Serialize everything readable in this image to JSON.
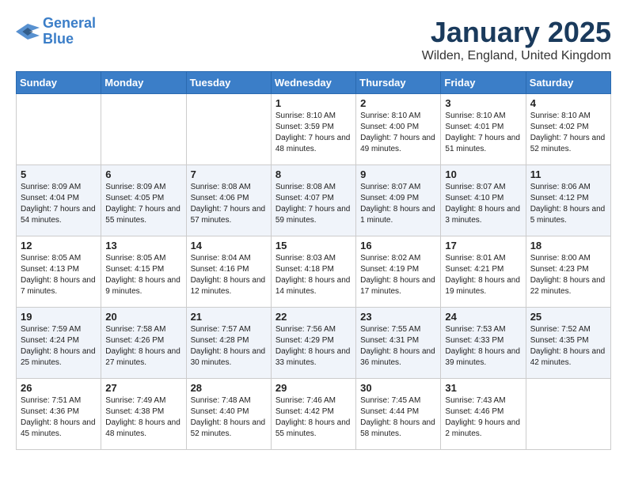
{
  "header": {
    "logo_line1": "General",
    "logo_line2": "Blue",
    "month": "January 2025",
    "location": "Wilden, England, United Kingdom"
  },
  "days_of_week": [
    "Sunday",
    "Monday",
    "Tuesday",
    "Wednesday",
    "Thursday",
    "Friday",
    "Saturday"
  ],
  "weeks": [
    [
      {
        "day": "",
        "detail": ""
      },
      {
        "day": "",
        "detail": ""
      },
      {
        "day": "",
        "detail": ""
      },
      {
        "day": "1",
        "detail": "Sunrise: 8:10 AM\nSunset: 3:59 PM\nDaylight: 7 hours\nand 48 minutes."
      },
      {
        "day": "2",
        "detail": "Sunrise: 8:10 AM\nSunset: 4:00 PM\nDaylight: 7 hours\nand 49 minutes."
      },
      {
        "day": "3",
        "detail": "Sunrise: 8:10 AM\nSunset: 4:01 PM\nDaylight: 7 hours\nand 51 minutes."
      },
      {
        "day": "4",
        "detail": "Sunrise: 8:10 AM\nSunset: 4:02 PM\nDaylight: 7 hours\nand 52 minutes."
      }
    ],
    [
      {
        "day": "5",
        "detail": "Sunrise: 8:09 AM\nSunset: 4:04 PM\nDaylight: 7 hours\nand 54 minutes."
      },
      {
        "day": "6",
        "detail": "Sunrise: 8:09 AM\nSunset: 4:05 PM\nDaylight: 7 hours\nand 55 minutes."
      },
      {
        "day": "7",
        "detail": "Sunrise: 8:08 AM\nSunset: 4:06 PM\nDaylight: 7 hours\nand 57 minutes."
      },
      {
        "day": "8",
        "detail": "Sunrise: 8:08 AM\nSunset: 4:07 PM\nDaylight: 7 hours\nand 59 minutes."
      },
      {
        "day": "9",
        "detail": "Sunrise: 8:07 AM\nSunset: 4:09 PM\nDaylight: 8 hours\nand 1 minute."
      },
      {
        "day": "10",
        "detail": "Sunrise: 8:07 AM\nSunset: 4:10 PM\nDaylight: 8 hours\nand 3 minutes."
      },
      {
        "day": "11",
        "detail": "Sunrise: 8:06 AM\nSunset: 4:12 PM\nDaylight: 8 hours\nand 5 minutes."
      }
    ],
    [
      {
        "day": "12",
        "detail": "Sunrise: 8:05 AM\nSunset: 4:13 PM\nDaylight: 8 hours\nand 7 minutes."
      },
      {
        "day": "13",
        "detail": "Sunrise: 8:05 AM\nSunset: 4:15 PM\nDaylight: 8 hours\nand 9 minutes."
      },
      {
        "day": "14",
        "detail": "Sunrise: 8:04 AM\nSunset: 4:16 PM\nDaylight: 8 hours\nand 12 minutes."
      },
      {
        "day": "15",
        "detail": "Sunrise: 8:03 AM\nSunset: 4:18 PM\nDaylight: 8 hours\nand 14 minutes."
      },
      {
        "day": "16",
        "detail": "Sunrise: 8:02 AM\nSunset: 4:19 PM\nDaylight: 8 hours\nand 17 minutes."
      },
      {
        "day": "17",
        "detail": "Sunrise: 8:01 AM\nSunset: 4:21 PM\nDaylight: 8 hours\nand 19 minutes."
      },
      {
        "day": "18",
        "detail": "Sunrise: 8:00 AM\nSunset: 4:23 PM\nDaylight: 8 hours\nand 22 minutes."
      }
    ],
    [
      {
        "day": "19",
        "detail": "Sunrise: 7:59 AM\nSunset: 4:24 PM\nDaylight: 8 hours\nand 25 minutes."
      },
      {
        "day": "20",
        "detail": "Sunrise: 7:58 AM\nSunset: 4:26 PM\nDaylight: 8 hours\nand 27 minutes."
      },
      {
        "day": "21",
        "detail": "Sunrise: 7:57 AM\nSunset: 4:28 PM\nDaylight: 8 hours\nand 30 minutes."
      },
      {
        "day": "22",
        "detail": "Sunrise: 7:56 AM\nSunset: 4:29 PM\nDaylight: 8 hours\nand 33 minutes."
      },
      {
        "day": "23",
        "detail": "Sunrise: 7:55 AM\nSunset: 4:31 PM\nDaylight: 8 hours\nand 36 minutes."
      },
      {
        "day": "24",
        "detail": "Sunrise: 7:53 AM\nSunset: 4:33 PM\nDaylight: 8 hours\nand 39 minutes."
      },
      {
        "day": "25",
        "detail": "Sunrise: 7:52 AM\nSunset: 4:35 PM\nDaylight: 8 hours\nand 42 minutes."
      }
    ],
    [
      {
        "day": "26",
        "detail": "Sunrise: 7:51 AM\nSunset: 4:36 PM\nDaylight: 8 hours\nand 45 minutes."
      },
      {
        "day": "27",
        "detail": "Sunrise: 7:49 AM\nSunset: 4:38 PM\nDaylight: 8 hours\nand 48 minutes."
      },
      {
        "day": "28",
        "detail": "Sunrise: 7:48 AM\nSunset: 4:40 PM\nDaylight: 8 hours\nand 52 minutes."
      },
      {
        "day": "29",
        "detail": "Sunrise: 7:46 AM\nSunset: 4:42 PM\nDaylight: 8 hours\nand 55 minutes."
      },
      {
        "day": "30",
        "detail": "Sunrise: 7:45 AM\nSunset: 4:44 PM\nDaylight: 8 hours\nand 58 minutes."
      },
      {
        "day": "31",
        "detail": "Sunrise: 7:43 AM\nSunset: 4:46 PM\nDaylight: 9 hours\nand 2 minutes."
      },
      {
        "day": "",
        "detail": ""
      }
    ]
  ]
}
